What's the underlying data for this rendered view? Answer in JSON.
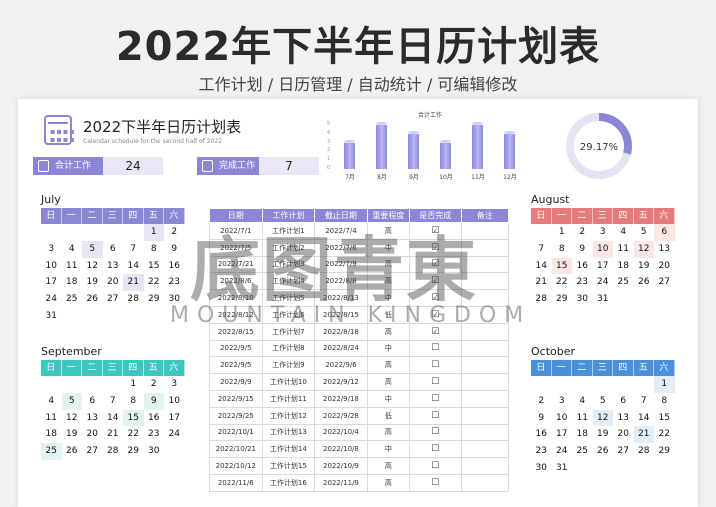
{
  "banner": {
    "title": "2022年下半年日历计划表",
    "subtitle": "工作计划 / 日历管理 / 自动统计 / 可编辑修改"
  },
  "header": {
    "title": "2022下半年日历计划表",
    "subtitle": "Calendar schedule for the second half of 2022"
  },
  "stats": {
    "total_label": "合计工作",
    "total_value": "24",
    "done_label": "完成工作",
    "done_value": "7",
    "percent": "29.17%",
    "percent_value": 0.2917
  },
  "chart_data": {
    "type": "bar",
    "title": "合计工作",
    "categories": [
      "7月",
      "8月",
      "9月",
      "10月",
      "11月",
      "12月"
    ],
    "values": [
      3,
      5,
      4,
      3,
      5,
      4
    ],
    "ylim": [
      0,
      5
    ]
  },
  "weekdays": [
    "日",
    "一",
    "二",
    "三",
    "四",
    "五",
    "六"
  ],
  "months": {
    "july": {
      "name": "July",
      "color": "#8b86d6",
      "hl_class": "hl",
      "offset": 5,
      "days": [
        "1",
        "2",
        "3",
        "4",
        "5",
        "6",
        "7",
        "8",
        "9",
        "10",
        "11",
        "12",
        "13",
        "14",
        "15",
        "16",
        "17",
        "18",
        "19",
        "20",
        "21",
        "22",
        "23",
        "24",
        "25",
        "26",
        "27",
        "28",
        "29",
        "30",
        "31"
      ],
      "highlight": [
        "1",
        "5",
        "21"
      ]
    },
    "august": {
      "name": "August",
      "color": "#e67b7b",
      "hl_class": "hl2",
      "offset": 1,
      "days": [
        "1",
        "2",
        "3",
        "4",
        "5",
        "6",
        "7",
        "8",
        "9",
        "10",
        "11",
        "12",
        "13",
        "14",
        "15",
        "16",
        "17",
        "18",
        "19",
        "20",
        "21",
        "22",
        "23",
        "24",
        "25",
        "26",
        "27",
        "28",
        "29",
        "30",
        "31"
      ],
      "highlight": [
        "6",
        "10",
        "12",
        "15"
      ]
    },
    "september": {
      "name": "September",
      "color": "#3ec7c1",
      "hl_class": "hl3",
      "offset": 4,
      "days": [
        "1",
        "2",
        "3",
        "4",
        "5",
        "6",
        "7",
        "8",
        "9",
        "10",
        "11",
        "12",
        "13",
        "14",
        "15",
        "16",
        "17",
        "18",
        "19",
        "20",
        "21",
        "22",
        "23",
        "24",
        "25",
        "26",
        "27",
        "28",
        "29",
        "30"
      ],
      "highlight": [
        "5",
        "9",
        "15",
        "25"
      ]
    },
    "october": {
      "name": "October",
      "color": "#4a8fd9",
      "hl_class": "hl4",
      "offset": 6,
      "days": [
        "1",
        "2",
        "3",
        "4",
        "5",
        "6",
        "7",
        "8",
        "9",
        "10",
        "11",
        "12",
        "13",
        "14",
        "15",
        "16",
        "17",
        "18",
        "19",
        "20",
        "21",
        "22",
        "23",
        "24",
        "25",
        "26",
        "27",
        "28",
        "29",
        "30",
        "31"
      ],
      "highlight": [
        "1",
        "12",
        "21"
      ]
    }
  },
  "table": {
    "headers": [
      "日期",
      "工作计划",
      "截止日期",
      "重要程度",
      "是否完成",
      "备注"
    ],
    "rows": [
      [
        "2022/7/1",
        "工作计划1",
        "2022/7/4",
        "高",
        "☑",
        ""
      ],
      [
        "2022/7/5",
        "工作计划2",
        "2022/7/6",
        "中",
        "☑",
        ""
      ],
      [
        "2022/7/21",
        "工作计划3",
        "2022/7/9",
        "高",
        "☑",
        ""
      ],
      [
        "2022/8/6",
        "工作计划4",
        "2022/8/8",
        "高",
        "☑",
        ""
      ],
      [
        "2022/8/10",
        "工作计划5",
        "2022/8/13",
        "中",
        "☑",
        ""
      ],
      [
        "2022/8/12",
        "工作计划6",
        "2022/8/15",
        "低",
        "☑",
        ""
      ],
      [
        "2022/8/15",
        "工作计划7",
        "2022/8/18",
        "高",
        "☑",
        ""
      ],
      [
        "2022/9/5",
        "工作计划8",
        "2022/8/24",
        "中",
        "☐",
        ""
      ],
      [
        "2022/9/5",
        "工作计划9",
        "2022/9/6",
        "高",
        "☐",
        ""
      ],
      [
        "2022/9/9",
        "工作计划10",
        "2022/9/12",
        "高",
        "☐",
        ""
      ],
      [
        "2022/9/15",
        "工作计划11",
        "2022/9/18",
        "中",
        "☐",
        ""
      ],
      [
        "2022/9/25",
        "工作计划12",
        "2022/9/28",
        "低",
        "☐",
        ""
      ],
      [
        "2022/10/1",
        "工作计划13",
        "2022/10/4",
        "高",
        "☐",
        ""
      ],
      [
        "2022/10/21",
        "工作计划14",
        "2022/10/8",
        "中",
        "☐",
        ""
      ],
      [
        "2022/10/12",
        "工作计划15",
        "2022/10/9",
        "高",
        "☐",
        ""
      ],
      [
        "2022/11/6",
        "工作计划16",
        "2022/11/9",
        "高",
        "☐",
        ""
      ]
    ]
  },
  "watermark": {
    "main": "底图青東",
    "sub": "MOUNTAIN KINGDOM"
  }
}
